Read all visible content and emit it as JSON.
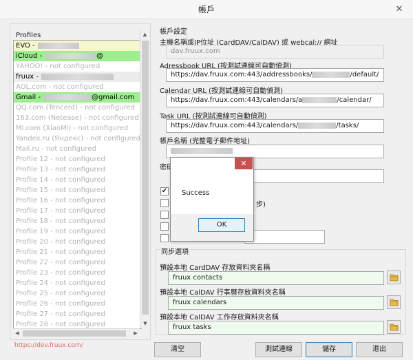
{
  "window": {
    "title": "帳戶",
    "close_glyph": "✕"
  },
  "profiles": {
    "legend": "Profiles",
    "items": [
      {
        "label": "EVO -",
        "style": "yellow",
        "redact_width": 60
      },
      {
        "label": "iCloud -",
        "style": "green",
        "redact_width": 75,
        "suffix": "@"
      },
      {
        "label": "YAHOO! - not configured",
        "style": "dis"
      },
      {
        "label": "fruux -",
        "style": "gray",
        "redact_width": 105
      },
      {
        "label": "AOL.com - not configured",
        "style": "dis"
      },
      {
        "label": "Gmail -",
        "style": "green",
        "redact_width": 70,
        "suffix": "@gmail.com"
      },
      {
        "label": "QQ.com (Tencent) - not configured",
        "style": "dis"
      },
      {
        "label": "163.com (Netease) - not configured",
        "style": "dis"
      },
      {
        "label": "MI.com (XiaoMi) - not configured",
        "style": "dis"
      },
      {
        "label": "Yandex.ru (Яндекс) - not configured",
        "style": "dis"
      },
      {
        "label": "Mail.ru - not configured",
        "style": "dis"
      },
      {
        "label": "Profile 12 - not configured",
        "style": "dis"
      },
      {
        "label": "Profile 13 - not configured",
        "style": "dis"
      },
      {
        "label": "Profile 14 - not configured",
        "style": "dis"
      },
      {
        "label": "Profile 15 - not configured",
        "style": "dis"
      },
      {
        "label": "Profile 16 - not configured",
        "style": "dis"
      },
      {
        "label": "Profile 17 - not configured",
        "style": "dis"
      },
      {
        "label": "Profile 18 - not configured",
        "style": "dis"
      },
      {
        "label": "Profile 19 - not configured",
        "style": "dis"
      },
      {
        "label": "Profile 20 - not configured",
        "style": "dis"
      },
      {
        "label": "Profile 21 - not configured",
        "style": "dis"
      },
      {
        "label": "Profile 22 - not configured",
        "style": "dis"
      },
      {
        "label": "Profile 23 - not configured",
        "style": "dis"
      },
      {
        "label": "Profile 24 - not configured",
        "style": "dis"
      },
      {
        "label": "Profile 25 - not configured",
        "style": "dis"
      },
      {
        "label": "Profile 26 - not configured",
        "style": "dis"
      },
      {
        "label": "Profile 27 - not configured",
        "style": "dis"
      },
      {
        "label": "Profile 28 - not configured",
        "style": "dis"
      }
    ],
    "link": "https://dev.fruux.com/"
  },
  "account": {
    "section": "帳戶設定",
    "server_label": "主機名稱或IP位址 (CardDAV/CalDAV) 或 webcal:// 網址",
    "server_value": "dav.fruux.com",
    "addressbook_label": "Adressbook URL (按測試連線可自動偵測)",
    "addressbook_value_a": "https://dav.fruux.com:443/addressbooks/",
    "addressbook_value_b": "/default/",
    "calendar_label": "Calendar URL (按測試連線可自動偵測)",
    "calendar_value_a": "https://dav.fruux.com:443/calendars/a",
    "calendar_value_b": "/calendar/",
    "task_label": "Task URL (按測試連線可自動偵測)",
    "task_value_a": "https://dav.fruux.com:443/calendars/",
    "task_value_b": "/tasks/",
    "account_label": "帳戶名稱 (完整電子郵件地址)",
    "password_label_partial": "密碼",
    "partial_text": "步)",
    "checkboxes": [
      "checked",
      "unchecked",
      "unchecked",
      "unchecked",
      "unchecked"
    ],
    "check_glyph": "✔"
  },
  "sync": {
    "section": "同步選項",
    "carddav_label": "預設本地 CardDAV 存放資料夾名稱",
    "carddav_value": "fruux contacts",
    "caldav_label": "預設本地 CalDAV 行事曆存放資料夾名稱",
    "caldav_value": "fruux calendars",
    "tasks_label": "預設本地 CalDAV 工作存放資料夾名稱",
    "tasks_value": "fruux tasks"
  },
  "buttons": {
    "clear": "清空",
    "test": "測試連線",
    "save": "儲存",
    "exit": "退出"
  },
  "dialog": {
    "message": "Success",
    "ok": "OK",
    "close_glyph": "✕"
  },
  "colors": {
    "highlight_green": "#9cee8e",
    "highlight_yellow": "#f7f7cc",
    "dialog_close": "#c75050",
    "link": "#e06b6b"
  }
}
